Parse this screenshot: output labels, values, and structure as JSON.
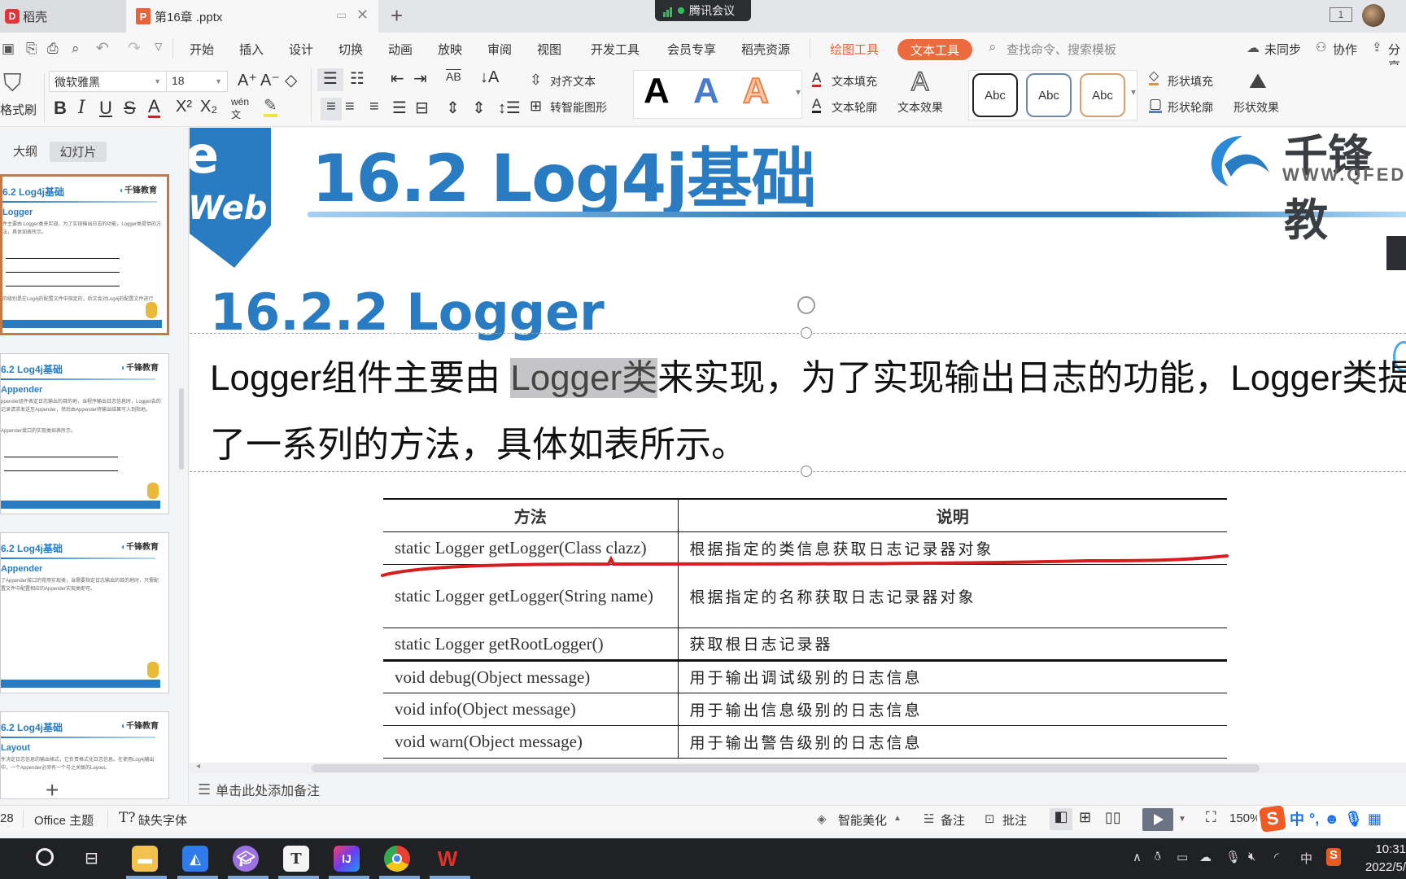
{
  "titlebar": {
    "home_tab": "稻壳",
    "doc_tab": "第16章 .pptx",
    "meeting_label": "腾讯会议",
    "window_badge": "1"
  },
  "menubar": {
    "items": [
      "开始",
      "插入",
      "设计",
      "切换",
      "动画",
      "放映",
      "审阅",
      "视图",
      "开发工具",
      "会员专享",
      "稻壳资源"
    ],
    "draw_tool": "绘图工具",
    "text_tool": "文本工具",
    "search_placeholder": "查找命令、搜索模板",
    "sync": "未同步",
    "collab": "协作",
    "share": "分享"
  },
  "ribbon": {
    "format_painter": "格式刷",
    "font_name": "微软雅黑",
    "font_size": "18",
    "align_text": "对齐文本",
    "smart_shape": "转智能图形",
    "wordart_samples": [
      "A",
      "A",
      "A"
    ],
    "text_fill": "文本填充",
    "text_outline": "文本轮廓",
    "text_effect": "文本效果",
    "shape_styles": [
      "Abc",
      "Abc",
      "Abc"
    ],
    "shape_fill": "形状填充",
    "shape_outline": "形状轮廓",
    "shape_effect": "形状效果",
    "pinyin": "wén"
  },
  "left_panel": {
    "tab_outline": "大纲",
    "tab_slides": "幻灯片",
    "thumbnails": [
      {
        "title": "6.2 Log4j基础",
        "subtitle": "Logger",
        "text": "件主要由 Logger类来实现，为了实现输出日志的功能，Logger类提供的方法，具体如表所示。",
        "footer_text": "的级别是在Log4j的配置文件中指定的，后文会对Log4j的配置文件进行",
        "selected": true
      },
      {
        "title": "6.2 Log4j基础",
        "subtitle": "Appender",
        "text": "ppender组件表定日志输出的目的地，当程序输出日志信息时，Logger会的记录请求发送至Appender，然后由Appender将输出结果写入到指地。",
        "footer_text": "Appender接口的实现类如表所示。",
        "selected": false
      },
      {
        "title": "6.2 Log4j基础",
        "subtitle": "Appender",
        "text": "了Appender接口的常用实现类，当需要指定日志输出的目的地时，只需配置文件中配置相应的Appender实现类即可。",
        "footer_text": "",
        "selected": false
      },
      {
        "title": "6.2 Log4j基础",
        "subtitle": "Layout",
        "text": "件决定日志信息的输出格式，它负责格式化日志信息。在使用Log4j输出中，一个Appender必须有一个与之关联的Layout。",
        "footer_text": "",
        "selected": false
      }
    ],
    "thumb_logo": "千锋教育",
    "add_slide": "+"
  },
  "slide": {
    "badge_text": "Web",
    "badge_letter": "e",
    "title": "16.2 Log4j基础",
    "brand_name": "千锋教",
    "brand_url": "WWW.QFEDU",
    "subtitle": "16.2.2 Logger",
    "body_before": "Logger组件主要由 ",
    "body_highlight": "Logger类",
    "body_after": "来实现，为了实现输出日志的功能，Logger类提供",
    "body_line2": "了一系列的方法，具体如表所示。",
    "table": {
      "headers": [
        "方法",
        "说明"
      ],
      "rows": [
        [
          "static Logger getLogger(Class clazz)",
          "根据指定的类信息获取日志记录器对象"
        ],
        [
          "static Logger getLogger(String name)",
          "根据指定的名称获取日志记录器对象"
        ],
        [
          "static Logger getRootLogger()",
          "获取根日志记录器"
        ],
        [
          "void debug(Object message)",
          "用于输出调试级别的日志信息"
        ],
        [
          "void info(Object message)",
          "用于输出信息级别的日志信息"
        ],
        [
          "void warn(Object message)",
          "用于输出警告级别的日志信息"
        ]
      ]
    },
    "annotation_color": "#d42020"
  },
  "notes": {
    "placeholder": "单击此处添加备注"
  },
  "statusbar": {
    "slide_count": "28",
    "theme": "Office 主题",
    "missing_font": "缺失字体",
    "smart_beautify": "智能美化",
    "notes": "备注",
    "comment": "批注",
    "zoom": "150%"
  },
  "ime": {
    "lang": "中",
    "punct": "°,"
  },
  "taskbar": {
    "tray_lang": "中",
    "time": "10:31",
    "date": "2022/5/"
  },
  "colors": {
    "accent_orange": "#ec6b3e",
    "slide_blue": "#2a7cc2",
    "thumb_selected": "#c27a4b"
  }
}
